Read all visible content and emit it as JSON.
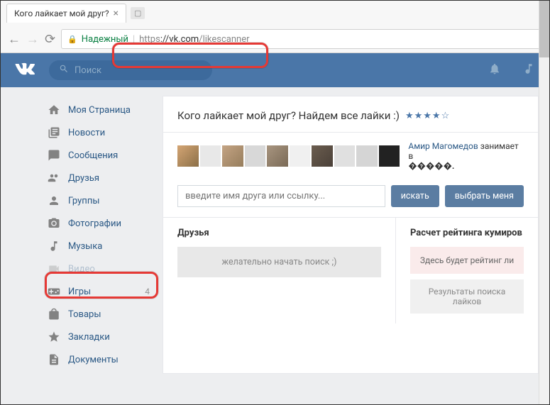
{
  "browser": {
    "tab_title": "Кого лайкает мой друг?",
    "secure_label": "Надежный",
    "url_proto": "https",
    "url_host": "://vk.com",
    "url_path": "/likescanner"
  },
  "header": {
    "search_placeholder": "Поиск"
  },
  "sidebar": {
    "items": [
      {
        "label": "Моя Страница",
        "icon": "home"
      },
      {
        "label": "Новости",
        "icon": "news"
      },
      {
        "label": "Сообщения",
        "icon": "message"
      },
      {
        "label": "Друзья",
        "icon": "friends"
      },
      {
        "label": "Группы",
        "icon": "groups"
      },
      {
        "label": "Фотографии",
        "icon": "photos"
      },
      {
        "label": "Музыка",
        "icon": "music"
      },
      {
        "label": "Видео",
        "icon": "video"
      },
      {
        "label": "Игры",
        "icon": "games",
        "badge": "4"
      },
      {
        "label": "Товары",
        "icon": "market"
      },
      {
        "label": "Закладки",
        "icon": "bookmarks"
      },
      {
        "label": "Документы",
        "icon": "docs"
      }
    ]
  },
  "app": {
    "title": "Кого лайкает мой друг? Найдем все лайки :)",
    "stars": "★★★★☆",
    "user_name": "Амир Магомедов",
    "user_status": "занимает в",
    "user_rank": "�����.",
    "input_placeholder": "введите имя друга или ссылку...",
    "btn_search": "искать",
    "btn_self": "выбрать меня",
    "panel_friends_title": "Друзья",
    "panel_friends_hint": "желательно начать поиск ;)",
    "panel_rating_title": "Расчет рейтинга кумиров",
    "panel_rating_hint": "Здесь будет рейтинг ли",
    "panel_results": "Результаты поиска лайков"
  }
}
